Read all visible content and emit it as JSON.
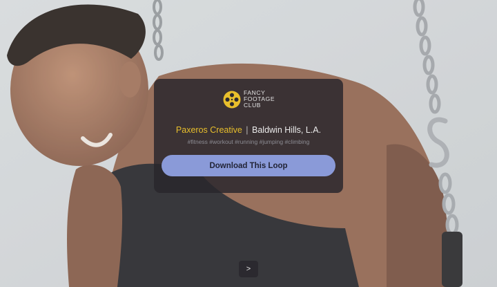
{
  "background": {
    "description_icon": "man-on-rings-video-background",
    "accent": "#8a9ad8"
  },
  "card": {
    "logo_lines": [
      "FANCY",
      "FOOTAGE",
      "CLUB"
    ],
    "logo_icon": "film-reel-icon",
    "logo_color": "#e8bf2c",
    "credit_brand": "Paxeros Creative",
    "credit_separator": "|",
    "credit_location": "Baldwin Hills, L.A.",
    "tags": "#fitness #workout #running #jumping #climbing",
    "download_label": "Download This Loop"
  },
  "nav": {
    "next_label": ">"
  }
}
